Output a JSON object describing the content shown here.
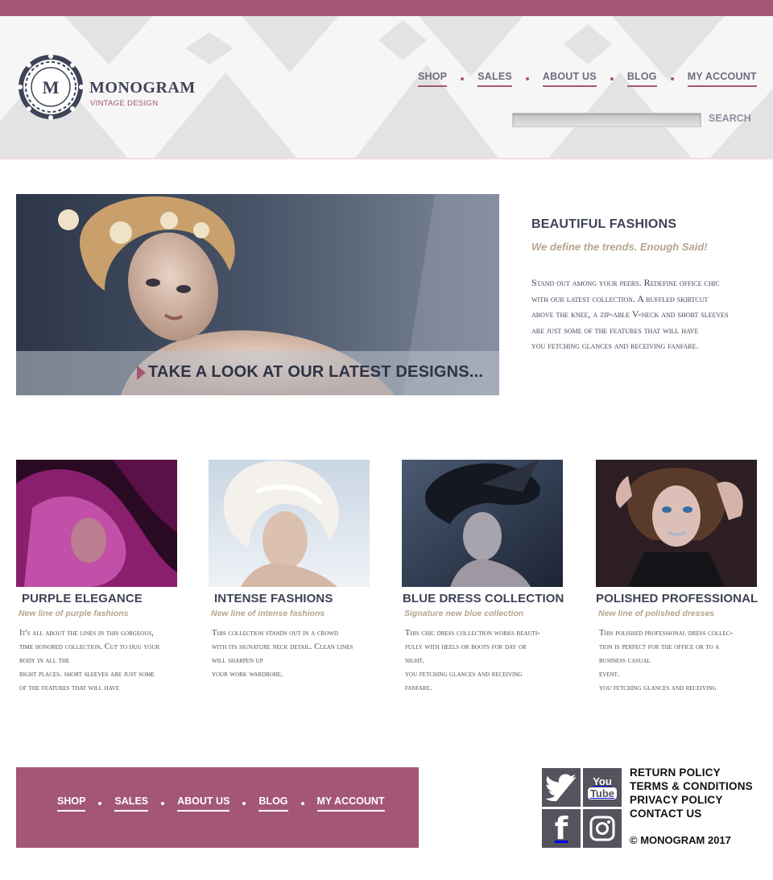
{
  "header": {
    "brand": "MONOGRAM",
    "brand_letter": "M",
    "tagline": "VINTAGE DESIGN",
    "nav": [
      {
        "label": "SHOP"
      },
      {
        "label": "SALES"
      },
      {
        "label": "ABOUT US"
      },
      {
        "label": "BLOG"
      },
      {
        "label": "MY ACCOUNT"
      }
    ],
    "search_button": "SEARCH",
    "search_value": ""
  },
  "hero": {
    "cta": "TAKE A LOOK AT OUR LATEST DESIGNS..."
  },
  "feature": {
    "title": "BEAUTIFUL FASHIONS",
    "subtitle": "We define the trends. Enough Said!",
    "body": "Stand out among your peers. Redefine office chic\nwith our latest collection. A ruffled skirtcut\nabove the knee, a zip-able V-neck and short sleeves\nare just some of the features that will have\nyou fetching glances and receiving fanfare."
  },
  "cards": [
    {
      "title": "PURPLE ELEGANCE",
      "subtitle": "New line of purple fashions",
      "body": "It's all about the lines in this gorgeous,\ntime honored collection. Cut to hug your\nbody in all the\nright places. short sleeves are just some\nof the features that will have"
    },
    {
      "title": "INTENSE FASHIONS",
      "subtitle": "New line of intense fashions",
      "body": "This collection stands out in a crowd\nwith its signature neck detail. Clean lines\nwill sharpen up\nyour work wardrobe."
    },
    {
      "title": "BLUE DRESS COLLECTION",
      "subtitle": "Signature new blue collection",
      "body": "This chic dress collection works beauti-\nfully with heels or boots for day or\nnight.\nyou fetching glances and receiving\nfanfare."
    },
    {
      "title": "POLISHED PROFESSIONAL",
      "subtitle": "New line of polished dresses",
      "body": "This polished professional dress collec-\ntion is perfect for the office or to a\nbusiness casual\nevent.\nyou fetching glances and receiving"
    }
  ],
  "footer": {
    "nav": [
      {
        "label": "SHOP"
      },
      {
        "label": "SALES"
      },
      {
        "label": "ABOUT US"
      },
      {
        "label": "BLOG"
      },
      {
        "label": "MY ACCOUNT"
      }
    ],
    "links": [
      {
        "label": "RETURN POLICY"
      },
      {
        "label": "TERMS & CONDITIONS"
      },
      {
        "label": "PRIVACY POLICY"
      },
      {
        "label": "CONTACT US"
      }
    ],
    "copyright": "© MONOGRAM 2017",
    "social": [
      {
        "icon": "twitter-icon"
      },
      {
        "icon": "youtube-icon",
        "label_top": "You",
        "label_bottom": "Tube"
      },
      {
        "icon": "facebook-icon",
        "label": "f"
      },
      {
        "icon": "instagram-icon"
      }
    ]
  },
  "colors": {
    "accent": "#a35676",
    "heading": "#3e4356",
    "subtitle": "#b5a58d",
    "social_tile": "#54545e"
  }
}
